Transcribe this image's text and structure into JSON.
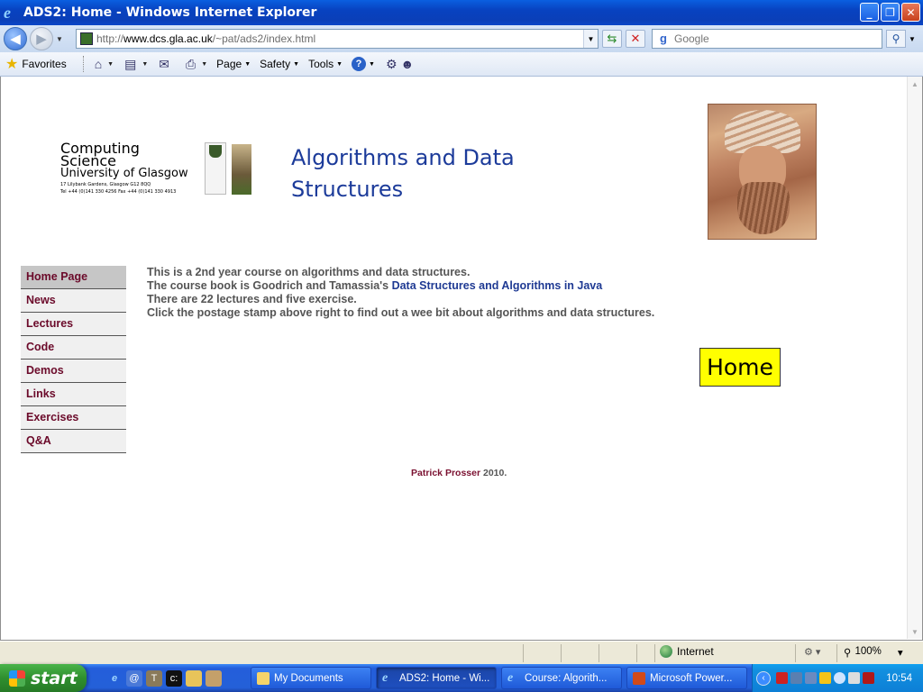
{
  "window": {
    "title": "ADS2: Home - Windows Internet Explorer",
    "buttons": {
      "minimize": "_",
      "maximize": "❐",
      "close": "✕"
    }
  },
  "addressbar": {
    "url_prefix": "http://",
    "url_host": "www.dcs.gla.ac.uk",
    "url_path": "/~pat/ads2/index.html"
  },
  "search": {
    "placeholder": "Google"
  },
  "commandbar": {
    "favorites": "Favorites",
    "menus": [
      "Page",
      "Safety",
      "Tools"
    ]
  },
  "page": {
    "logo": {
      "line1": "Computing",
      "line2": "Science",
      "line3": "University of Glasgow",
      "address": "17 Lilybank Gardens, Glasgow G12 8QQ",
      "phone": "Tel +44 (0)141 330 4256 Fax +44 (0)141 330 4913"
    },
    "title": "Algorithms and Data Structures",
    "nav": [
      {
        "label": "Home Page",
        "active": true
      },
      {
        "label": "News"
      },
      {
        "label": "Lectures"
      },
      {
        "label": "Code"
      },
      {
        "label": "Demos"
      },
      {
        "label": "Links"
      },
      {
        "label": "Exercises"
      },
      {
        "label": "Q&A"
      }
    ],
    "content": {
      "line1": "This is a 2nd year course on algorithms and data structures.",
      "line2_pre": "The course book is Goodrich and Tamassia's ",
      "line2_link": "Data Structures and Algorithms in Java",
      "line3": "There are 22 lectures and five exercise.",
      "line4": "Click the postage stamp above right to find out a wee bit about algorithms and data structures."
    },
    "home_badge": "Home",
    "footer": {
      "author": "Patrick Prosser",
      "year": " 2010."
    }
  },
  "statusbar": {
    "zone": "Internet",
    "zoom": "100%"
  },
  "taskbar": {
    "start": "start",
    "tasks": [
      {
        "label": "My Documents",
        "icon": "folder-icon"
      },
      {
        "label": "ADS2: Home - Wi...",
        "icon": "ie-icon",
        "active": true
      },
      {
        "label": "Course: Algorith...",
        "icon": "ie-icon"
      },
      {
        "label": "Microsoft Power...",
        "icon": "powerpoint-icon"
      }
    ],
    "clock": "10:54"
  }
}
